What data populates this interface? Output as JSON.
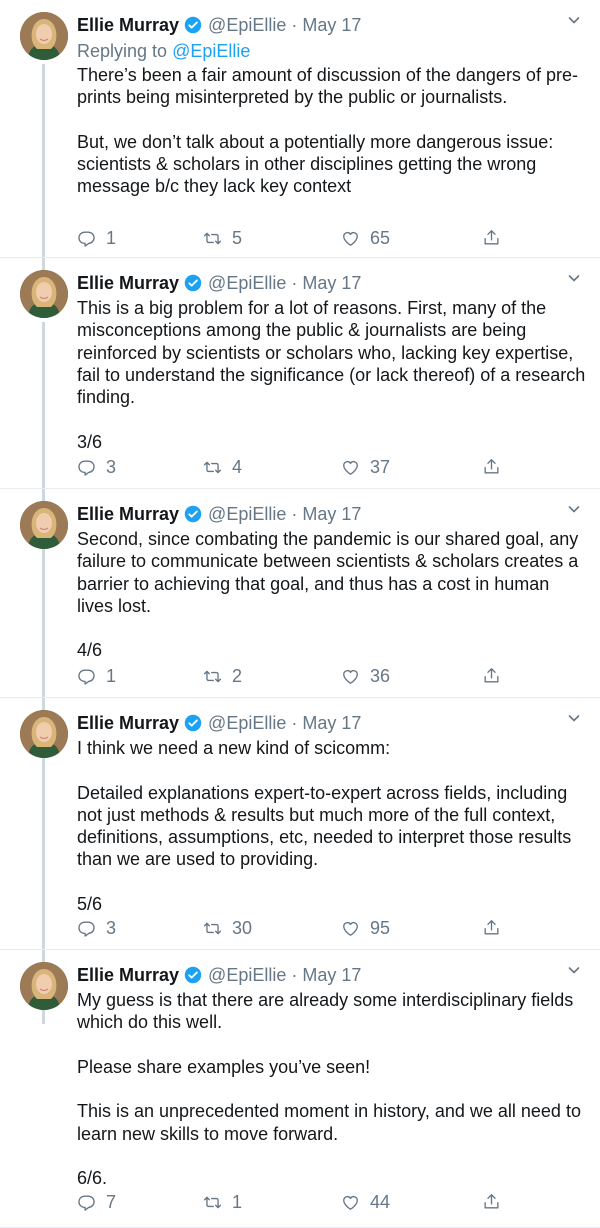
{
  "author": {
    "name": "Ellie Murray",
    "handle": "@EpiEllie",
    "date": "May 17"
  },
  "colors": {
    "accent": "#1da1f2",
    "muted": "#657786",
    "text": "#14171a",
    "divider": "#e6ecf0"
  },
  "tweets": [
    {
      "replying_prefix": "Replying to ",
      "replying_handle": "@EpiEllie",
      "text": "There’s been a fair amount of discussion of the dangers of pre-prints being misinterpreted by the public or journalists.\n\nBut, we don’t talk about a potentially more dangerous issue: scientists & scholars in other disciplines getting the wrong message b/c they lack key context",
      "replies": "1",
      "retweets": "5",
      "likes": "65"
    },
    {
      "text": "This is a big problem for a lot of reasons. First, many of the misconceptions among the public & journalists are being reinforced by scientists or scholars who, lacking key expertise, fail to understand the significance (or lack thereof) of a research finding.\n\n3/6",
      "replies": "3",
      "retweets": "4",
      "likes": "37"
    },
    {
      "text": "Second, since combating the pandemic is our shared goal, any failure to communicate between scientists & scholars creates a barrier to achieving that goal, and thus has a cost in human lives lost.\n\n4/6",
      "replies": "1",
      "retweets": "2",
      "likes": "36"
    },
    {
      "text": "I think we need a new kind of scicomm:\n\nDetailed explanations expert-to-expert across fields, including not just methods & results but much more of the full context, definitions, assumptions, etc, needed to interpret those results than we are used to providing.\n\n5/6",
      "replies": "3",
      "retweets": "30",
      "likes": "95"
    },
    {
      "text": "My guess is that there are already some interdisciplinary fields which do this well.\n\nPlease share examples you’ve seen!\n\nThis is an unprecedented moment in history, and we all need to learn new skills to move forward.\n\n6/6.",
      "replies": "7",
      "retweets": "1",
      "likes": "44"
    }
  ]
}
